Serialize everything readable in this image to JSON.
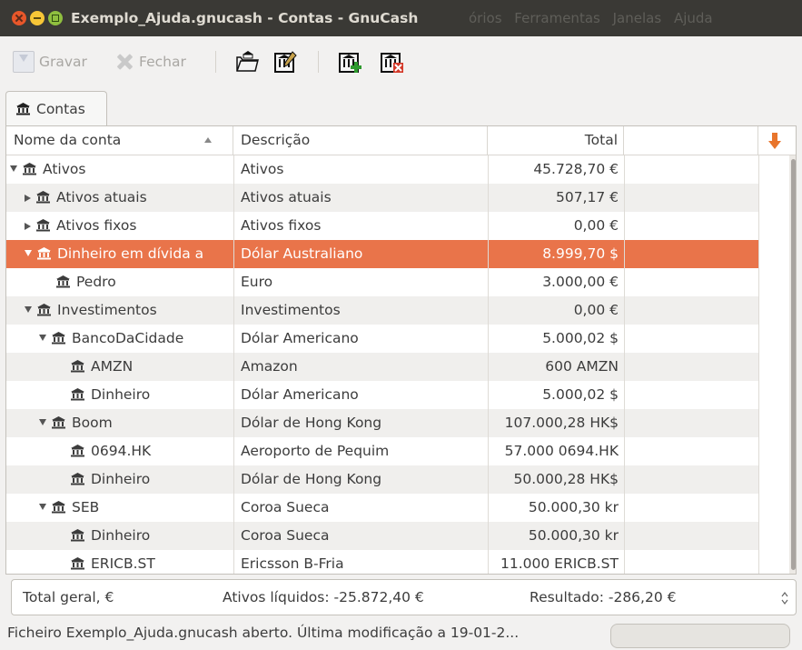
{
  "window": {
    "title": "Exemplo_Ajuda.gnucash - Contas - GnuCash",
    "menus": [
      "órios",
      "Ferramentas",
      "Janelas",
      "Ajuda"
    ]
  },
  "toolbar": {
    "save_label": "Gravar",
    "close_label": "Fechar"
  },
  "tabs": [
    {
      "label": "Contas"
    }
  ],
  "table": {
    "columns": {
      "name": "Nome da conta",
      "description": "Descrição",
      "total": "Total"
    },
    "rows": [
      {
        "name": "Ativos",
        "description": "Ativos",
        "total": "45.728,70 €",
        "depth": 0,
        "expander": "open"
      },
      {
        "name": "Ativos atuais",
        "description": "Ativos atuais",
        "total": "507,17 €",
        "depth": 1,
        "expander": "closed"
      },
      {
        "name": "Ativos fixos",
        "description": "Ativos fixos",
        "total": "0,00 €",
        "depth": 1,
        "expander": "closed"
      },
      {
        "name": "Dinheiro em dívida a",
        "description": "Dólar Australiano",
        "total": "8.999,70 $",
        "depth": 1,
        "expander": "open",
        "selected": true
      },
      {
        "name": "Pedro",
        "description": "Euro",
        "total": "3.000,00 €",
        "depth": 2,
        "expander": "none"
      },
      {
        "name": "Investimentos",
        "description": "Investimentos",
        "total": "0,00 €",
        "depth": 1,
        "expander": "open"
      },
      {
        "name": "BancoDaCidade",
        "description": "Dólar Americano",
        "total": "5.000,02 $",
        "depth": 2,
        "expander": "open"
      },
      {
        "name": "AMZN",
        "description": "Amazon",
        "total": "600 AMZN",
        "depth": 3,
        "expander": "none"
      },
      {
        "name": "Dinheiro",
        "description": "Dólar Americano",
        "total": "5.000,02 $",
        "depth": 3,
        "expander": "none"
      },
      {
        "name": "Boom",
        "description": "Dólar de Hong Kong",
        "total": "107.000,28 HK$",
        "depth": 2,
        "expander": "open"
      },
      {
        "name": "0694.HK",
        "description": "Aeroporto de Pequim",
        "total": "57.000 0694.HK",
        "depth": 3,
        "expander": "none"
      },
      {
        "name": "Dinheiro",
        "description": "Dólar de Hong Kong",
        "total": "50.000,28 HK$",
        "depth": 3,
        "expander": "none"
      },
      {
        "name": "SEB",
        "description": "Coroa Sueca",
        "total": "50.000,30 kr",
        "depth": 2,
        "expander": "open"
      },
      {
        "name": "Dinheiro",
        "description": "Coroa Sueca",
        "total": "50.000,30 kr",
        "depth": 3,
        "expander": "none"
      },
      {
        "name": "ERICB.ST",
        "description": "Ericsson B-Fria",
        "total": "11.000 ERICB.ST",
        "depth": 3,
        "expander": "none"
      }
    ]
  },
  "summary": {
    "label": "Total geral, €",
    "net_assets": "Ativos líquidos: -25.872,40 €",
    "result": "Resultado: -286,20 €"
  },
  "status": {
    "message": "Ficheiro Exemplo_Ajuda.gnucash aberto. Última modificação a 19-01-2..."
  },
  "colors": {
    "selection": "#e9744a",
    "titlebar": "#3a3935",
    "accent_arrow": "#e8752c"
  }
}
